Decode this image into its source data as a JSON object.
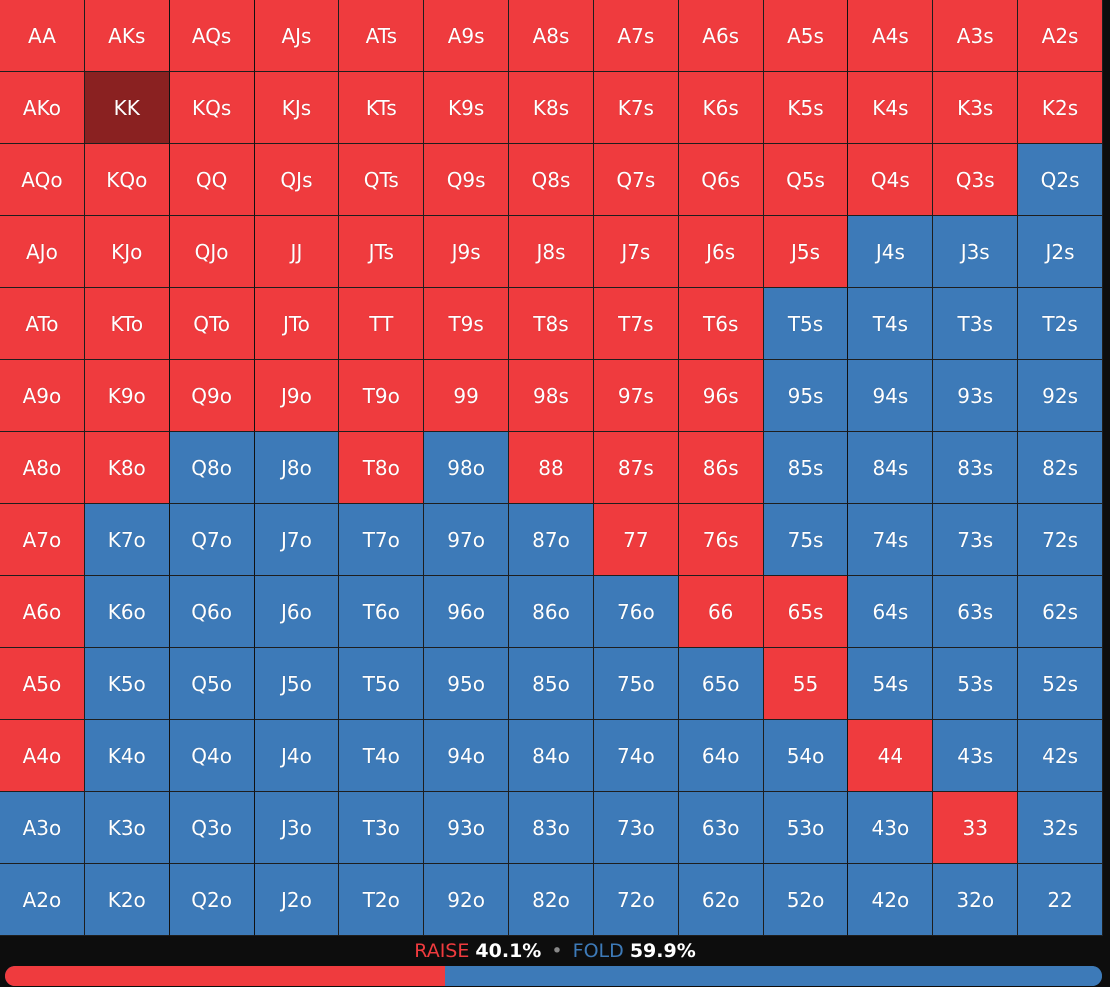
{
  "colors": {
    "raise": "#ef3b3e",
    "fold": "#3d7ab8",
    "selected": "#8a2121",
    "background": "#0d0d0d"
  },
  "grid": {
    "selected_hand": "KK",
    "rows": [
      [
        [
          "AA",
          "raise"
        ],
        [
          "AKs",
          "raise"
        ],
        [
          "AQs",
          "raise"
        ],
        [
          "AJs",
          "raise"
        ],
        [
          "ATs",
          "raise"
        ],
        [
          "A9s",
          "raise"
        ],
        [
          "A8s",
          "raise"
        ],
        [
          "A7s",
          "raise"
        ],
        [
          "A6s",
          "raise"
        ],
        [
          "A5s",
          "raise"
        ],
        [
          "A4s",
          "raise"
        ],
        [
          "A3s",
          "raise"
        ],
        [
          "A2s",
          "raise"
        ]
      ],
      [
        [
          "AKo",
          "raise"
        ],
        [
          "KK",
          "raise"
        ],
        [
          "KQs",
          "raise"
        ],
        [
          "KJs",
          "raise"
        ],
        [
          "KTs",
          "raise"
        ],
        [
          "K9s",
          "raise"
        ],
        [
          "K8s",
          "raise"
        ],
        [
          "K7s",
          "raise"
        ],
        [
          "K6s",
          "raise"
        ],
        [
          "K5s",
          "raise"
        ],
        [
          "K4s",
          "raise"
        ],
        [
          "K3s",
          "raise"
        ],
        [
          "K2s",
          "raise"
        ]
      ],
      [
        [
          "AQo",
          "raise"
        ],
        [
          "KQo",
          "raise"
        ],
        [
          "QQ",
          "raise"
        ],
        [
          "QJs",
          "raise"
        ],
        [
          "QTs",
          "raise"
        ],
        [
          "Q9s",
          "raise"
        ],
        [
          "Q8s",
          "raise"
        ],
        [
          "Q7s",
          "raise"
        ],
        [
          "Q6s",
          "raise"
        ],
        [
          "Q5s",
          "raise"
        ],
        [
          "Q4s",
          "raise"
        ],
        [
          "Q3s",
          "raise"
        ],
        [
          "Q2s",
          "fold"
        ]
      ],
      [
        [
          "AJo",
          "raise"
        ],
        [
          "KJo",
          "raise"
        ],
        [
          "QJo",
          "raise"
        ],
        [
          "JJ",
          "raise"
        ],
        [
          "JTs",
          "raise"
        ],
        [
          "J9s",
          "raise"
        ],
        [
          "J8s",
          "raise"
        ],
        [
          "J7s",
          "raise"
        ],
        [
          "J6s",
          "raise"
        ],
        [
          "J5s",
          "raise"
        ],
        [
          "J4s",
          "fold"
        ],
        [
          "J3s",
          "fold"
        ],
        [
          "J2s",
          "fold"
        ]
      ],
      [
        [
          "ATo",
          "raise"
        ],
        [
          "KTo",
          "raise"
        ],
        [
          "QTo",
          "raise"
        ],
        [
          "JTo",
          "raise"
        ],
        [
          "TT",
          "raise"
        ],
        [
          "T9s",
          "raise"
        ],
        [
          "T8s",
          "raise"
        ],
        [
          "T7s",
          "raise"
        ],
        [
          "T6s",
          "raise"
        ],
        [
          "T5s",
          "fold"
        ],
        [
          "T4s",
          "fold"
        ],
        [
          "T3s",
          "fold"
        ],
        [
          "T2s",
          "fold"
        ]
      ],
      [
        [
          "A9o",
          "raise"
        ],
        [
          "K9o",
          "raise"
        ],
        [
          "Q9o",
          "raise"
        ],
        [
          "J9o",
          "raise"
        ],
        [
          "T9o",
          "raise"
        ],
        [
          "99",
          "raise"
        ],
        [
          "98s",
          "raise"
        ],
        [
          "97s",
          "raise"
        ],
        [
          "96s",
          "raise"
        ],
        [
          "95s",
          "fold"
        ],
        [
          "94s",
          "fold"
        ],
        [
          "93s",
          "fold"
        ],
        [
          "92s",
          "fold"
        ]
      ],
      [
        [
          "A8o",
          "raise"
        ],
        [
          "K8o",
          "raise"
        ],
        [
          "Q8o",
          "fold"
        ],
        [
          "J8o",
          "fold"
        ],
        [
          "T8o",
          "raise"
        ],
        [
          "98o",
          "fold"
        ],
        [
          "88",
          "raise"
        ],
        [
          "87s",
          "raise"
        ],
        [
          "86s",
          "raise"
        ],
        [
          "85s",
          "fold"
        ],
        [
          "84s",
          "fold"
        ],
        [
          "83s",
          "fold"
        ],
        [
          "82s",
          "fold"
        ]
      ],
      [
        [
          "A7o",
          "raise"
        ],
        [
          "K7o",
          "fold"
        ],
        [
          "Q7o",
          "fold"
        ],
        [
          "J7o",
          "fold"
        ],
        [
          "T7o",
          "fold"
        ],
        [
          "97o",
          "fold"
        ],
        [
          "87o",
          "fold"
        ],
        [
          "77",
          "raise"
        ],
        [
          "76s",
          "raise"
        ],
        [
          "75s",
          "fold"
        ],
        [
          "74s",
          "fold"
        ],
        [
          "73s",
          "fold"
        ],
        [
          "72s",
          "fold"
        ]
      ],
      [
        [
          "A6o",
          "raise"
        ],
        [
          "K6o",
          "fold"
        ],
        [
          "Q6o",
          "fold"
        ],
        [
          "J6o",
          "fold"
        ],
        [
          "T6o",
          "fold"
        ],
        [
          "96o",
          "fold"
        ],
        [
          "86o",
          "fold"
        ],
        [
          "76o",
          "fold"
        ],
        [
          "66",
          "raise"
        ],
        [
          "65s",
          "raise"
        ],
        [
          "64s",
          "fold"
        ],
        [
          "63s",
          "fold"
        ],
        [
          "62s",
          "fold"
        ]
      ],
      [
        [
          "A5o",
          "raise"
        ],
        [
          "K5o",
          "fold"
        ],
        [
          "Q5o",
          "fold"
        ],
        [
          "J5o",
          "fold"
        ],
        [
          "T5o",
          "fold"
        ],
        [
          "95o",
          "fold"
        ],
        [
          "85o",
          "fold"
        ],
        [
          "75o",
          "fold"
        ],
        [
          "65o",
          "fold"
        ],
        [
          "55",
          "raise"
        ],
        [
          "54s",
          "fold"
        ],
        [
          "53s",
          "fold"
        ],
        [
          "52s",
          "fold"
        ]
      ],
      [
        [
          "A4o",
          "raise"
        ],
        [
          "K4o",
          "fold"
        ],
        [
          "Q4o",
          "fold"
        ],
        [
          "J4o",
          "fold"
        ],
        [
          "T4o",
          "fold"
        ],
        [
          "94o",
          "fold"
        ],
        [
          "84o",
          "fold"
        ],
        [
          "74o",
          "fold"
        ],
        [
          "64o",
          "fold"
        ],
        [
          "54o",
          "fold"
        ],
        [
          "44",
          "raise"
        ],
        [
          "43s",
          "fold"
        ],
        [
          "42s",
          "fold"
        ]
      ],
      [
        [
          "A3o",
          "fold"
        ],
        [
          "K3o",
          "fold"
        ],
        [
          "Q3o",
          "fold"
        ],
        [
          "J3o",
          "fold"
        ],
        [
          "T3o",
          "fold"
        ],
        [
          "93o",
          "fold"
        ],
        [
          "83o",
          "fold"
        ],
        [
          "73o",
          "fold"
        ],
        [
          "63o",
          "fold"
        ],
        [
          "53o",
          "fold"
        ],
        [
          "43o",
          "fold"
        ],
        [
          "33",
          "raise"
        ],
        [
          "32s",
          "fold"
        ]
      ],
      [
        [
          "A2o",
          "fold"
        ],
        [
          "K2o",
          "fold"
        ],
        [
          "Q2o",
          "fold"
        ],
        [
          "J2o",
          "fold"
        ],
        [
          "T2o",
          "fold"
        ],
        [
          "92o",
          "fold"
        ],
        [
          "82o",
          "fold"
        ],
        [
          "72o",
          "fold"
        ],
        [
          "62o",
          "fold"
        ],
        [
          "52o",
          "fold"
        ],
        [
          "42o",
          "fold"
        ],
        [
          "32o",
          "fold"
        ],
        [
          "22",
          "fold"
        ]
      ]
    ]
  },
  "summary": {
    "raise_label": "RAISE",
    "raise_pct": "40.1%",
    "separator": "•",
    "fold_label": "FOLD",
    "fold_pct": "59.9%",
    "raise_fraction": 0.401
  }
}
